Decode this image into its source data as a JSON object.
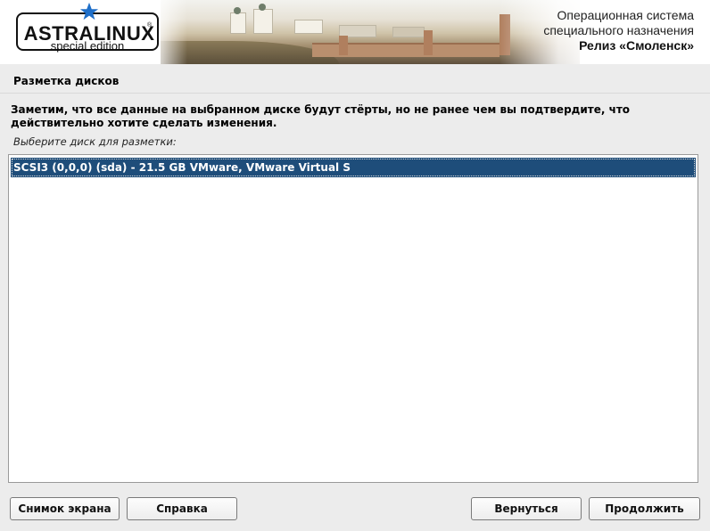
{
  "banner": {
    "logo_text": "ASTRALINUX",
    "logo_registered": "®",
    "logo_subtitle": "special edition",
    "os_title_line1": "Операционная система",
    "os_title_line2": "специального назначения",
    "release": "Релиз «Смоленск»"
  },
  "page": {
    "title": "Разметка дисков",
    "description": "Заметим, что все данные на выбранном диске будут стёрты, но не ранее чем вы подтвердите, что действительно хотите сделать изменения.",
    "list_label": "Выберите диск для разметки:"
  },
  "disks": [
    {
      "label": "SCSI3 (0,0,0) (sda) - 21.5 GB VMware, VMware Virtual S",
      "selected": true
    }
  ],
  "buttons": {
    "screenshot": "Снимок экрана",
    "help": "Справка",
    "back": "Вернуться",
    "continue": "Продолжить"
  },
  "colors": {
    "selection": "#1e4d7a",
    "background": "#ececec",
    "logo_star": "#1f6fc9"
  }
}
